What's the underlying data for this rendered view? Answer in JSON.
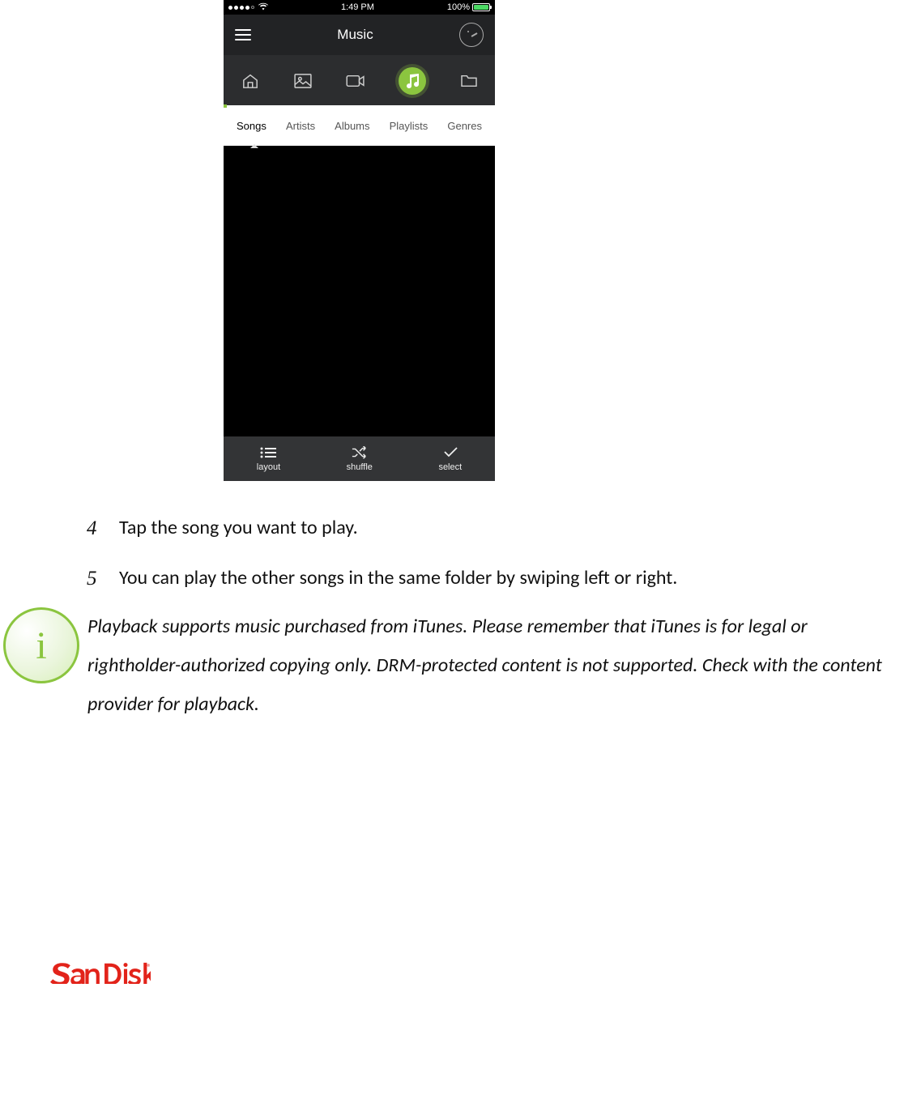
{
  "phone": {
    "status": {
      "time": "1:49 PM",
      "battery_text": "100%"
    },
    "nav_title": "Music",
    "type_icons": [
      "home-icon",
      "photo-icon",
      "video-icon",
      "music-icon",
      "folder-icon"
    ],
    "tabs": [
      "Songs",
      "Artists",
      "Albums",
      "Playlists",
      "Genres"
    ],
    "bottom": {
      "layout": "layout",
      "shuffle": "shuffle",
      "select": "select"
    }
  },
  "steps": [
    {
      "num": "4",
      "text": "Tap the song you want to play."
    },
    {
      "num": "5",
      "text": "You can play the other songs in the same folder by swiping left or right."
    }
  ],
  "info_text": "Playback supports music purchased from iTunes. Please remember that iTunes is for legal or rightholder-authorized copying only. DRM-protected content is not supported. Check with the content provider for playback.",
  "logo": "SanDisk",
  "info_badge_glyph": "i"
}
